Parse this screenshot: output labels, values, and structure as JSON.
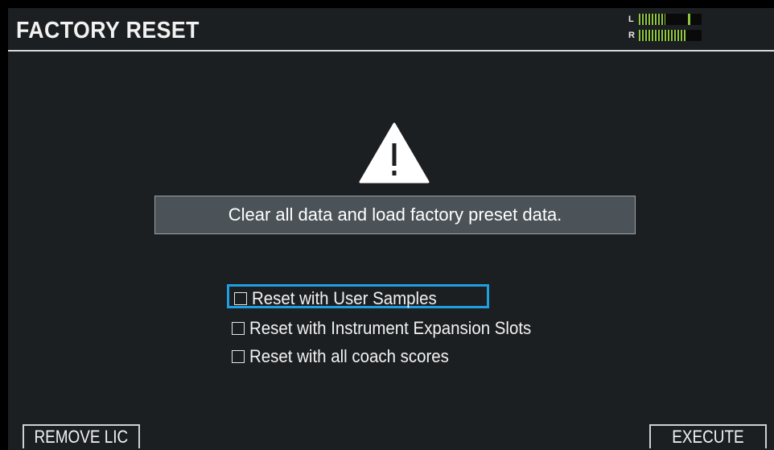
{
  "header": {
    "title": "FACTORY RESET",
    "meter": {
      "left_label": "L",
      "right_label": "R",
      "left_level": 0.42,
      "left_peak": 0.78,
      "right_level": 0.74,
      "meter_color": "#8fc63f"
    }
  },
  "warning": {
    "icon": "warning-triangle-icon",
    "message": "Clear all data and load factory preset data."
  },
  "options": [
    {
      "label": "Reset with User Samples",
      "checked": false,
      "selected": true
    },
    {
      "label": "Reset with Instrument Expansion Slots",
      "checked": false,
      "selected": false
    },
    {
      "label": "Reset with all coach scores",
      "checked": false,
      "selected": false
    }
  ],
  "function_buttons": {
    "left": "REMOVE LIC",
    "right": "EXECUTE"
  },
  "colors": {
    "background": "#1c1f22",
    "selection_outline": "#1f9fe0",
    "message_box": "#4b5359"
  }
}
